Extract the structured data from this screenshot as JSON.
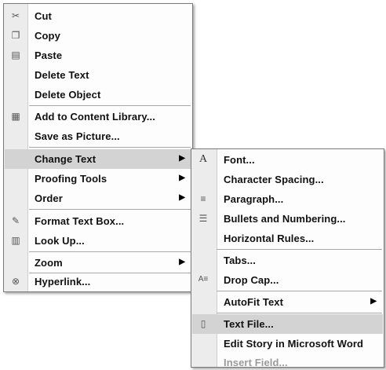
{
  "main_menu": {
    "items": [
      {
        "label": "Cut",
        "icon": "scissors-icon",
        "glyph": "✂"
      },
      {
        "label": "Copy",
        "icon": "copy-icon",
        "glyph": "❐"
      },
      {
        "label": "Paste",
        "icon": "paste-icon",
        "glyph": "▤"
      },
      {
        "label": "Delete Text"
      },
      {
        "label": "Delete Object"
      },
      {
        "label": "Add to Content Library...",
        "icon": "content-library-icon",
        "glyph": "▦"
      },
      {
        "label": "Save as Picture..."
      },
      {
        "label": "Change Text",
        "has_submenu": true,
        "highlighted": true
      },
      {
        "label": "Proofing Tools",
        "has_submenu": true
      },
      {
        "label": "Order",
        "has_submenu": true
      },
      {
        "label": "Format Text Box...",
        "icon": "format-text-box-icon",
        "glyph": "✎"
      },
      {
        "label": "Look Up...",
        "icon": "book-icon",
        "glyph": "▥"
      },
      {
        "label": "Zoom",
        "has_submenu": true
      },
      {
        "label": "Hyperlink...",
        "icon": "hyperlink-icon",
        "glyph": "⊗"
      }
    ]
  },
  "sub_menu": {
    "items": [
      {
        "label": "Font...",
        "icon": "font-icon",
        "glyph": "A"
      },
      {
        "label": "Character Spacing..."
      },
      {
        "label": "Paragraph...",
        "icon": "paragraph-icon",
        "glyph": "≡"
      },
      {
        "label": "Bullets and Numbering...",
        "icon": "bullets-icon",
        "glyph": "☰"
      },
      {
        "label": "Horizontal Rules..."
      },
      {
        "label": "Tabs..."
      },
      {
        "label": "Drop Cap...",
        "icon": "drop-cap-icon",
        "glyph": "A≡"
      },
      {
        "label": "AutoFit Text",
        "has_submenu": true
      },
      {
        "label": "Text File...",
        "icon": "text-file-icon",
        "glyph": "▯",
        "highlighted": true
      },
      {
        "label": "Edit Story in Microsoft Word"
      },
      {
        "label": "Insert Field...",
        "disabled": true
      }
    ]
  },
  "arrow_glyph": "▶",
  "colors": {
    "highlight": "#d3d3d3",
    "gutter": "#ececec",
    "disabled_text": "#9a9a9a"
  }
}
